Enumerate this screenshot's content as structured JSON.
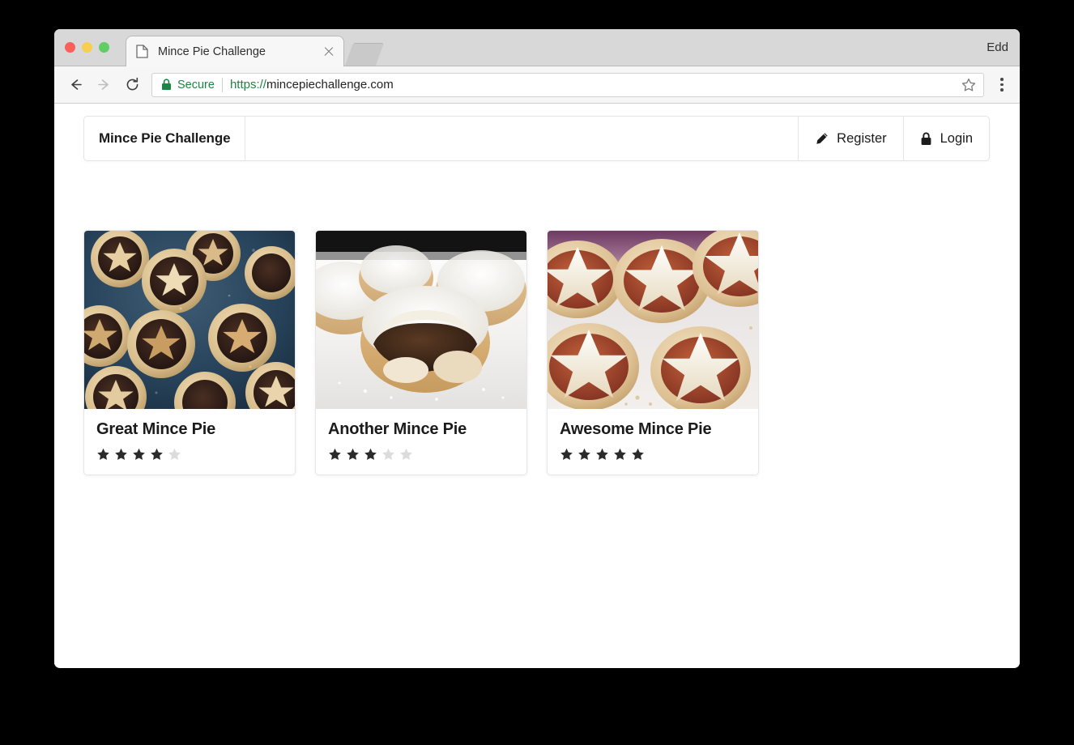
{
  "browser": {
    "tab": {
      "title": "Mince Pie Challenge",
      "favicon": "document-icon",
      "close": "close-icon"
    },
    "new_tab": "new-tab-button",
    "profile_name": "Edd",
    "toolbar": {
      "back": "back-arrow-icon",
      "forward": "forward-arrow-icon",
      "reload": "reload-icon",
      "security_icon": "padlock-icon",
      "security_label": "Secure",
      "url_scheme": "https://",
      "url_host": "mincepiechallenge.com",
      "bookmark": "star-icon",
      "menu": "kebab-menu-icon"
    },
    "colors": {
      "traffic_red": "#f96057",
      "traffic_yellow": "#f8ce52",
      "traffic_green": "#5fcf65",
      "secure_green": "#1d8544"
    }
  },
  "site": {
    "navbar": {
      "brand": "Mince Pie Challenge",
      "actions": [
        {
          "label": "Register",
          "icon": "pencil-icon"
        },
        {
          "label": "Login",
          "icon": "lock-icon"
        }
      ]
    },
    "cards": [
      {
        "title": "Great Mince Pie",
        "rating": 4,
        "max_rating": 5,
        "image_alt": "star-topped mince pies on dark blue slate"
      },
      {
        "title": "Another Mince Pie",
        "rating": 3,
        "max_rating": 5,
        "image_alt": "icing-sugar dusted mince pie with bite taken"
      },
      {
        "title": "Awesome Mince Pie",
        "rating": 5,
        "max_rating": 5,
        "image_alt": "star pastry mince pies dusted with icing sugar"
      }
    ],
    "colors": {
      "star_filled": "#2b2b2b",
      "star_empty": "#dcdcdc",
      "card_border": "#e6e6e6",
      "text": "#1b1b1b"
    }
  }
}
